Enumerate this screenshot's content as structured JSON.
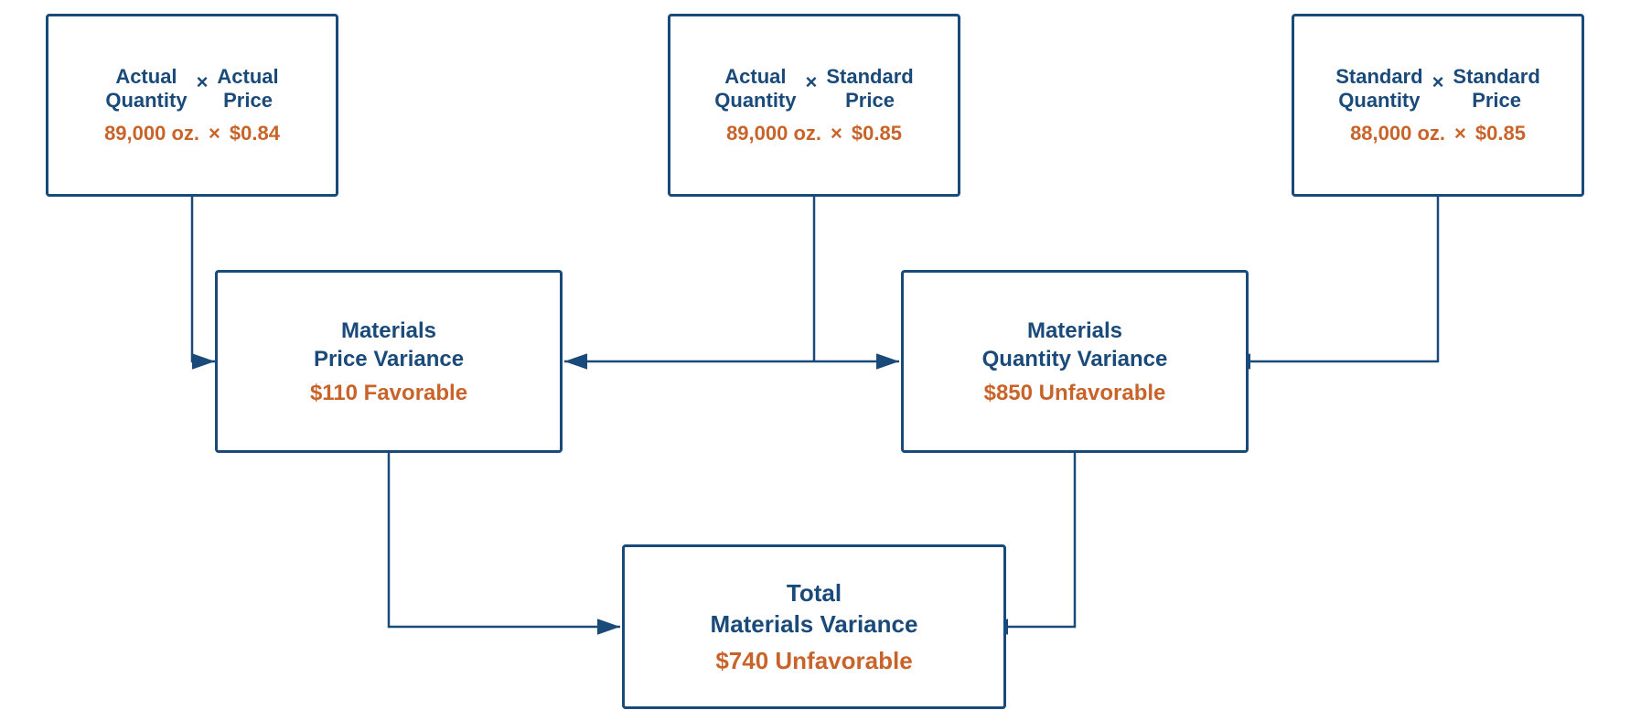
{
  "boxes": {
    "top_left": {
      "title1": "Actual",
      "title1b": "Quantity",
      "operator1": "×",
      "title2": "Actual",
      "title2b": "Price",
      "value1": "89,000 oz.",
      "operator2": "×",
      "value2": "$0.84"
    },
    "top_middle": {
      "title1": "Actual",
      "title1b": "Quantity",
      "operator1": "×",
      "title2": "Standard",
      "title2b": "Price",
      "value1": "89,000 oz.",
      "operator2": "×",
      "value2": "$0.85"
    },
    "top_right": {
      "title1": "Standard",
      "title1b": "Quantity",
      "operator1": "×",
      "title2": "Standard",
      "title2b": "Price",
      "value1": "88,000 oz.",
      "operator2": "×",
      "value2": "$0.85"
    },
    "mid_left": {
      "title": "Materials\nPrice Variance",
      "value": "$110 Favorable"
    },
    "mid_right": {
      "title": "Materials\nQuantity Variance",
      "value": "$850 Unfavorable"
    },
    "bottom": {
      "title": "Total\nMaterials Variance",
      "value": "$740 Unfavorable"
    }
  }
}
